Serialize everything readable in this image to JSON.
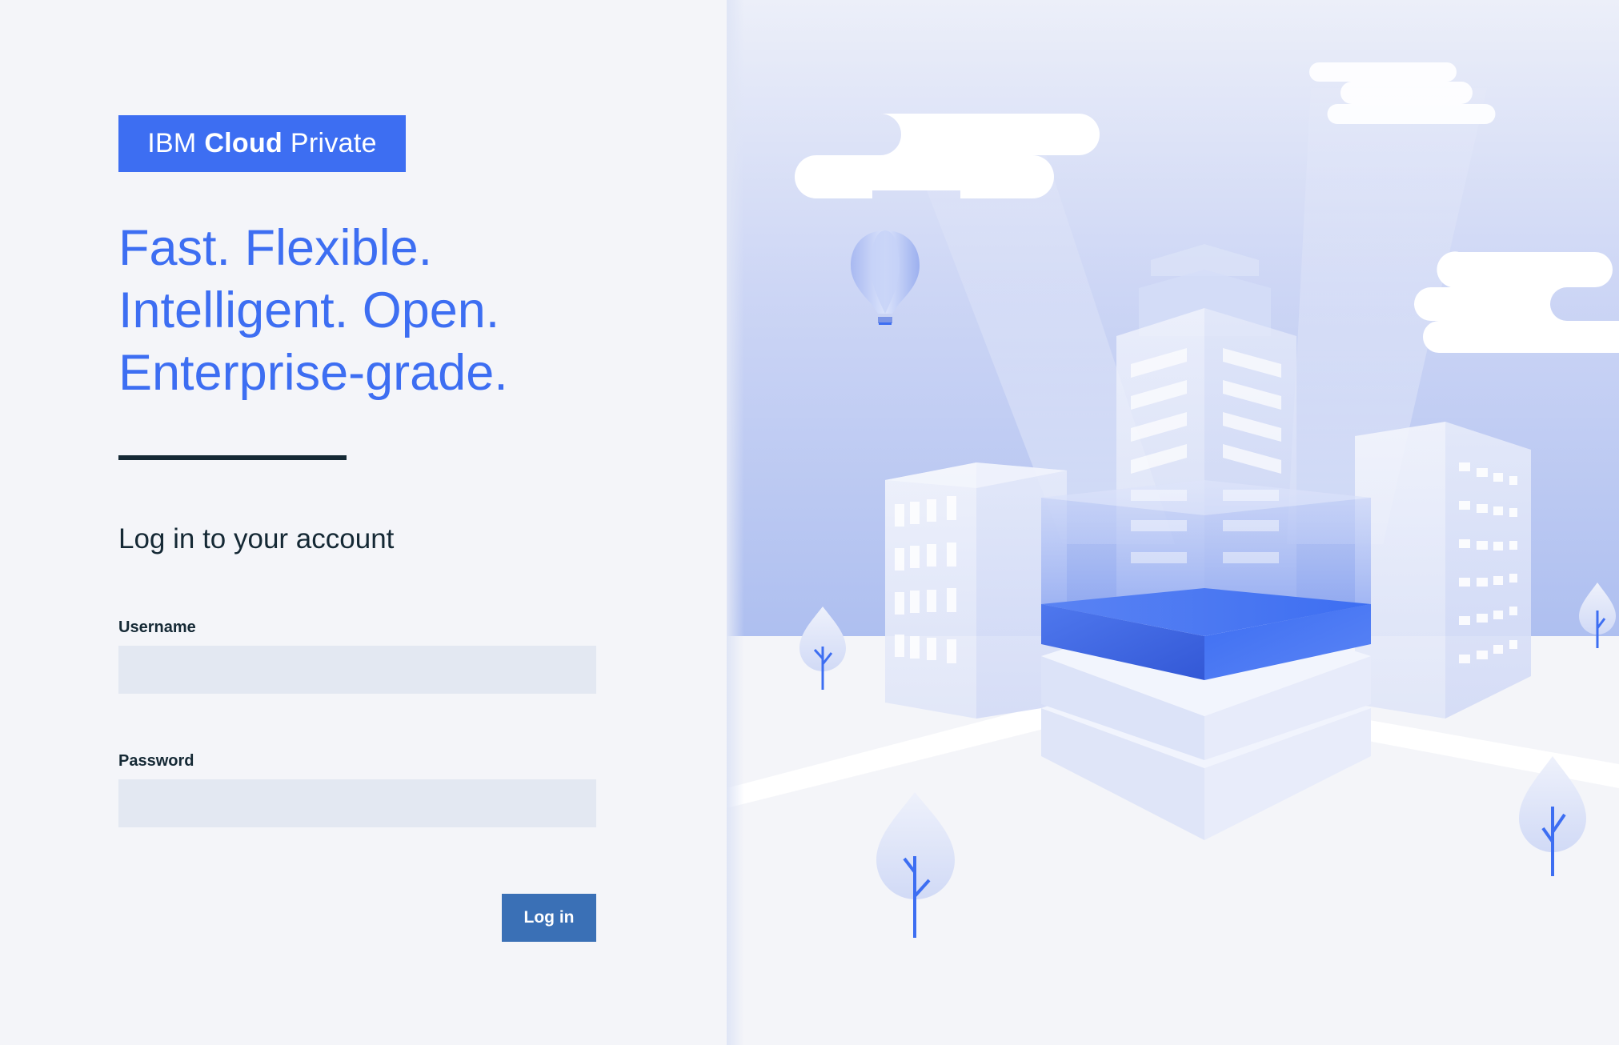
{
  "logo": {
    "brand": "IBM",
    "product_bold": "Cloud",
    "product_rest": "Private"
  },
  "tagline": [
    "Fast. Flexible.",
    "Intelligent. Open.",
    "Enterprise-grade."
  ],
  "login": {
    "heading": "Log in to your account",
    "username_label": "Username",
    "username_value": "",
    "password_label": "Password",
    "password_value": "",
    "submit_label": "Log in"
  },
  "illustration": {
    "icons": [
      "cloud-icon",
      "hot-air-balloon-icon",
      "building-icon",
      "data-platform-icon",
      "tree-icon"
    ]
  },
  "colors": {
    "accent": "#3d6ef2",
    "button": "#3a70b6",
    "text_dark": "#152935",
    "input_bg": "#e3e8f2",
    "panel_bg": "#f4f5f9"
  }
}
